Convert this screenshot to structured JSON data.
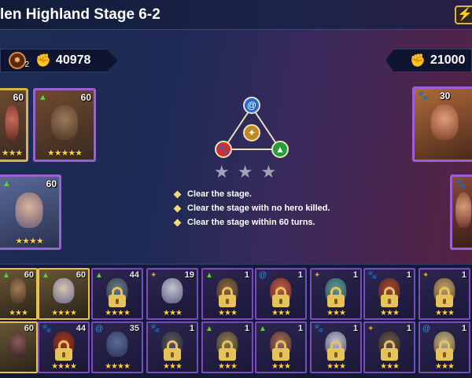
{
  "header": {
    "title": "len Highland Stage 6-2",
    "energy_icon": "lightning-icon"
  },
  "player": {
    "rank_level": "2",
    "power": "40978"
  },
  "enemy": {
    "power": "21000"
  },
  "player_team": [
    {
      "level": "60",
      "stars": "★★★",
      "faction": "",
      "frame": "gold"
    },
    {
      "level": "60",
      "stars": "★★★★★",
      "faction": "▲",
      "frame": "purple"
    },
    {
      "level": "60",
      "stars": "★★★★",
      "faction": "▲",
      "frame": "purple"
    }
  ],
  "enemy_team": [
    {
      "level": "30",
      "faction": "🐾"
    },
    {
      "level": "",
      "faction": "🐾"
    }
  ],
  "faction_bonus": {
    "top": "@",
    "center": "✦",
    "left": "🐾",
    "right": "▲"
  },
  "stage_stars": [
    "★",
    "★",
    "★"
  ],
  "objectives": [
    "Clear the stage.",
    "Clear the stage with no hero killed.",
    "Clear the stage within 60 turns."
  ],
  "roster": [
    {
      "level": "60",
      "stars": "★★★",
      "selected": true,
      "locked": false,
      "faction": "▲"
    },
    {
      "level": "60",
      "stars": "★★★★",
      "selected": true,
      "locked": false,
      "faction": "▲"
    },
    {
      "level": "44",
      "stars": "★★★★",
      "selected": false,
      "locked": true,
      "faction": "▲"
    },
    {
      "level": "19",
      "stars": "★★★",
      "selected": false,
      "locked": false,
      "faction": "✦"
    },
    {
      "level": "1",
      "stars": "★★★",
      "selected": false,
      "locked": true,
      "faction": "▲"
    },
    {
      "level": "1",
      "stars": "★★★",
      "selected": false,
      "locked": true,
      "faction": "@"
    },
    {
      "level": "1",
      "stars": "★★★",
      "selected": false,
      "locked": true,
      "faction": "✦"
    },
    {
      "level": "1",
      "stars": "★★★",
      "selected": false,
      "locked": true,
      "faction": "🐾"
    },
    {
      "level": "1",
      "stars": "★★★",
      "selected": false,
      "locked": true,
      "faction": "✦"
    },
    {
      "level": "60",
      "stars": "",
      "selected": true,
      "locked": false,
      "faction": ""
    },
    {
      "level": "44",
      "stars": "★★★★",
      "selected": false,
      "locked": true,
      "faction": "🐾"
    },
    {
      "level": "35",
      "stars": "★★★★",
      "selected": false,
      "locked": false,
      "faction": "@"
    },
    {
      "level": "1",
      "stars": "★★★",
      "selected": false,
      "locked": true,
      "faction": "🐾"
    },
    {
      "level": "1",
      "stars": "★★★",
      "selected": false,
      "locked": true,
      "faction": "▲"
    },
    {
      "level": "1",
      "stars": "★★★",
      "selected": false,
      "locked": true,
      "faction": "▲"
    },
    {
      "level": "1",
      "stars": "★★★",
      "selected": false,
      "locked": true,
      "faction": "🐾"
    },
    {
      "level": "1",
      "stars": "★★★",
      "selected": false,
      "locked": true,
      "faction": "✦"
    },
    {
      "level": "1",
      "stars": "★★★",
      "selected": false,
      "locked": true,
      "faction": "@"
    }
  ],
  "colors": {
    "frame_gold": "#d7b24a",
    "frame_purple": "#7a4bbf",
    "star": "#ffd23a",
    "lock": "#e6c35a",
    "faction_green": "#5fd04a",
    "faction_red": "#e0403a",
    "faction_blue": "#3a8ae0",
    "faction_gold": "#d9a030"
  }
}
